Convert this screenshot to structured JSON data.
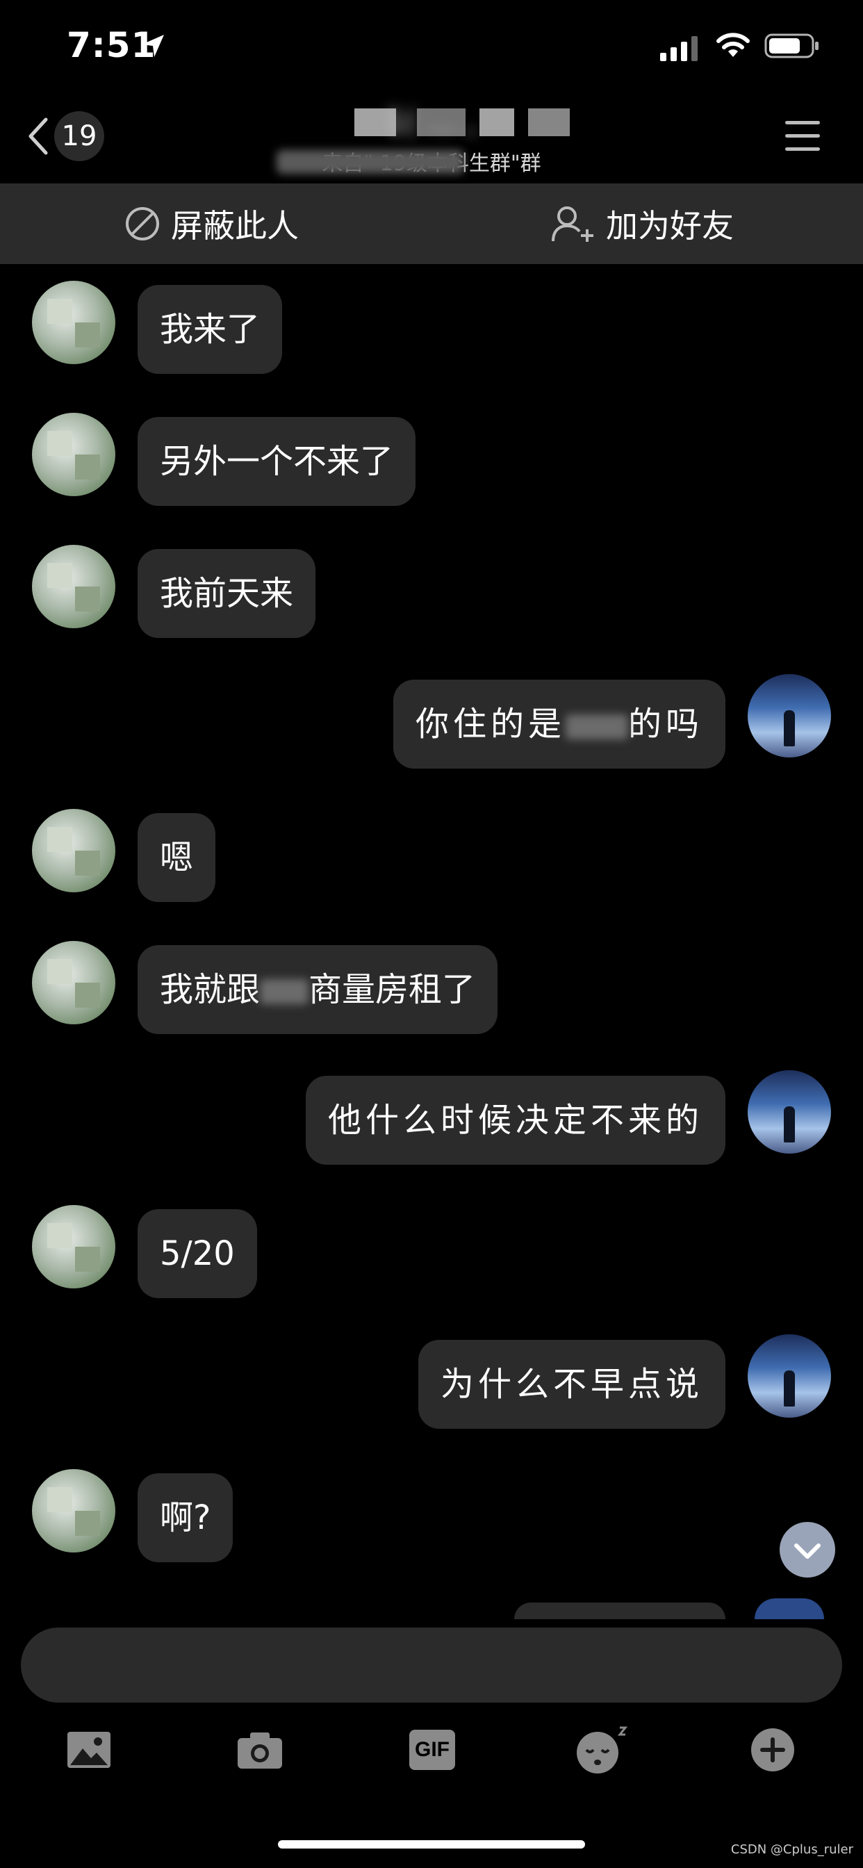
{
  "status": {
    "time": "7:51"
  },
  "header": {
    "back_count": "19",
    "title": "1( …  ,",
    "subtitle": "来自\"                             19级本科生群\"群"
  },
  "actions": {
    "block": "屏蔽此人",
    "add_friend": "加为好友"
  },
  "messages": [
    {
      "from": "other",
      "text": "我来了"
    },
    {
      "from": "other",
      "text": "另外一个不来了"
    },
    {
      "from": "other",
      "text": "我前天来"
    },
    {
      "from": "me",
      "text_before": "你住的是",
      "text_after": "的吗"
    },
    {
      "from": "other",
      "text": "嗯"
    },
    {
      "from": "other",
      "text_before": "我就跟",
      "text_after": "商量房租了"
    },
    {
      "from": "me",
      "text": "他什么时候决定不来的"
    },
    {
      "from": "other",
      "text": "5/20"
    },
    {
      "from": "me",
      "text": "为什么不早点说"
    },
    {
      "from": "other",
      "text": "啊?"
    }
  ],
  "toolbar": {
    "gif_label": "GIF"
  },
  "watermark": "CSDN @Cplus_ruler"
}
